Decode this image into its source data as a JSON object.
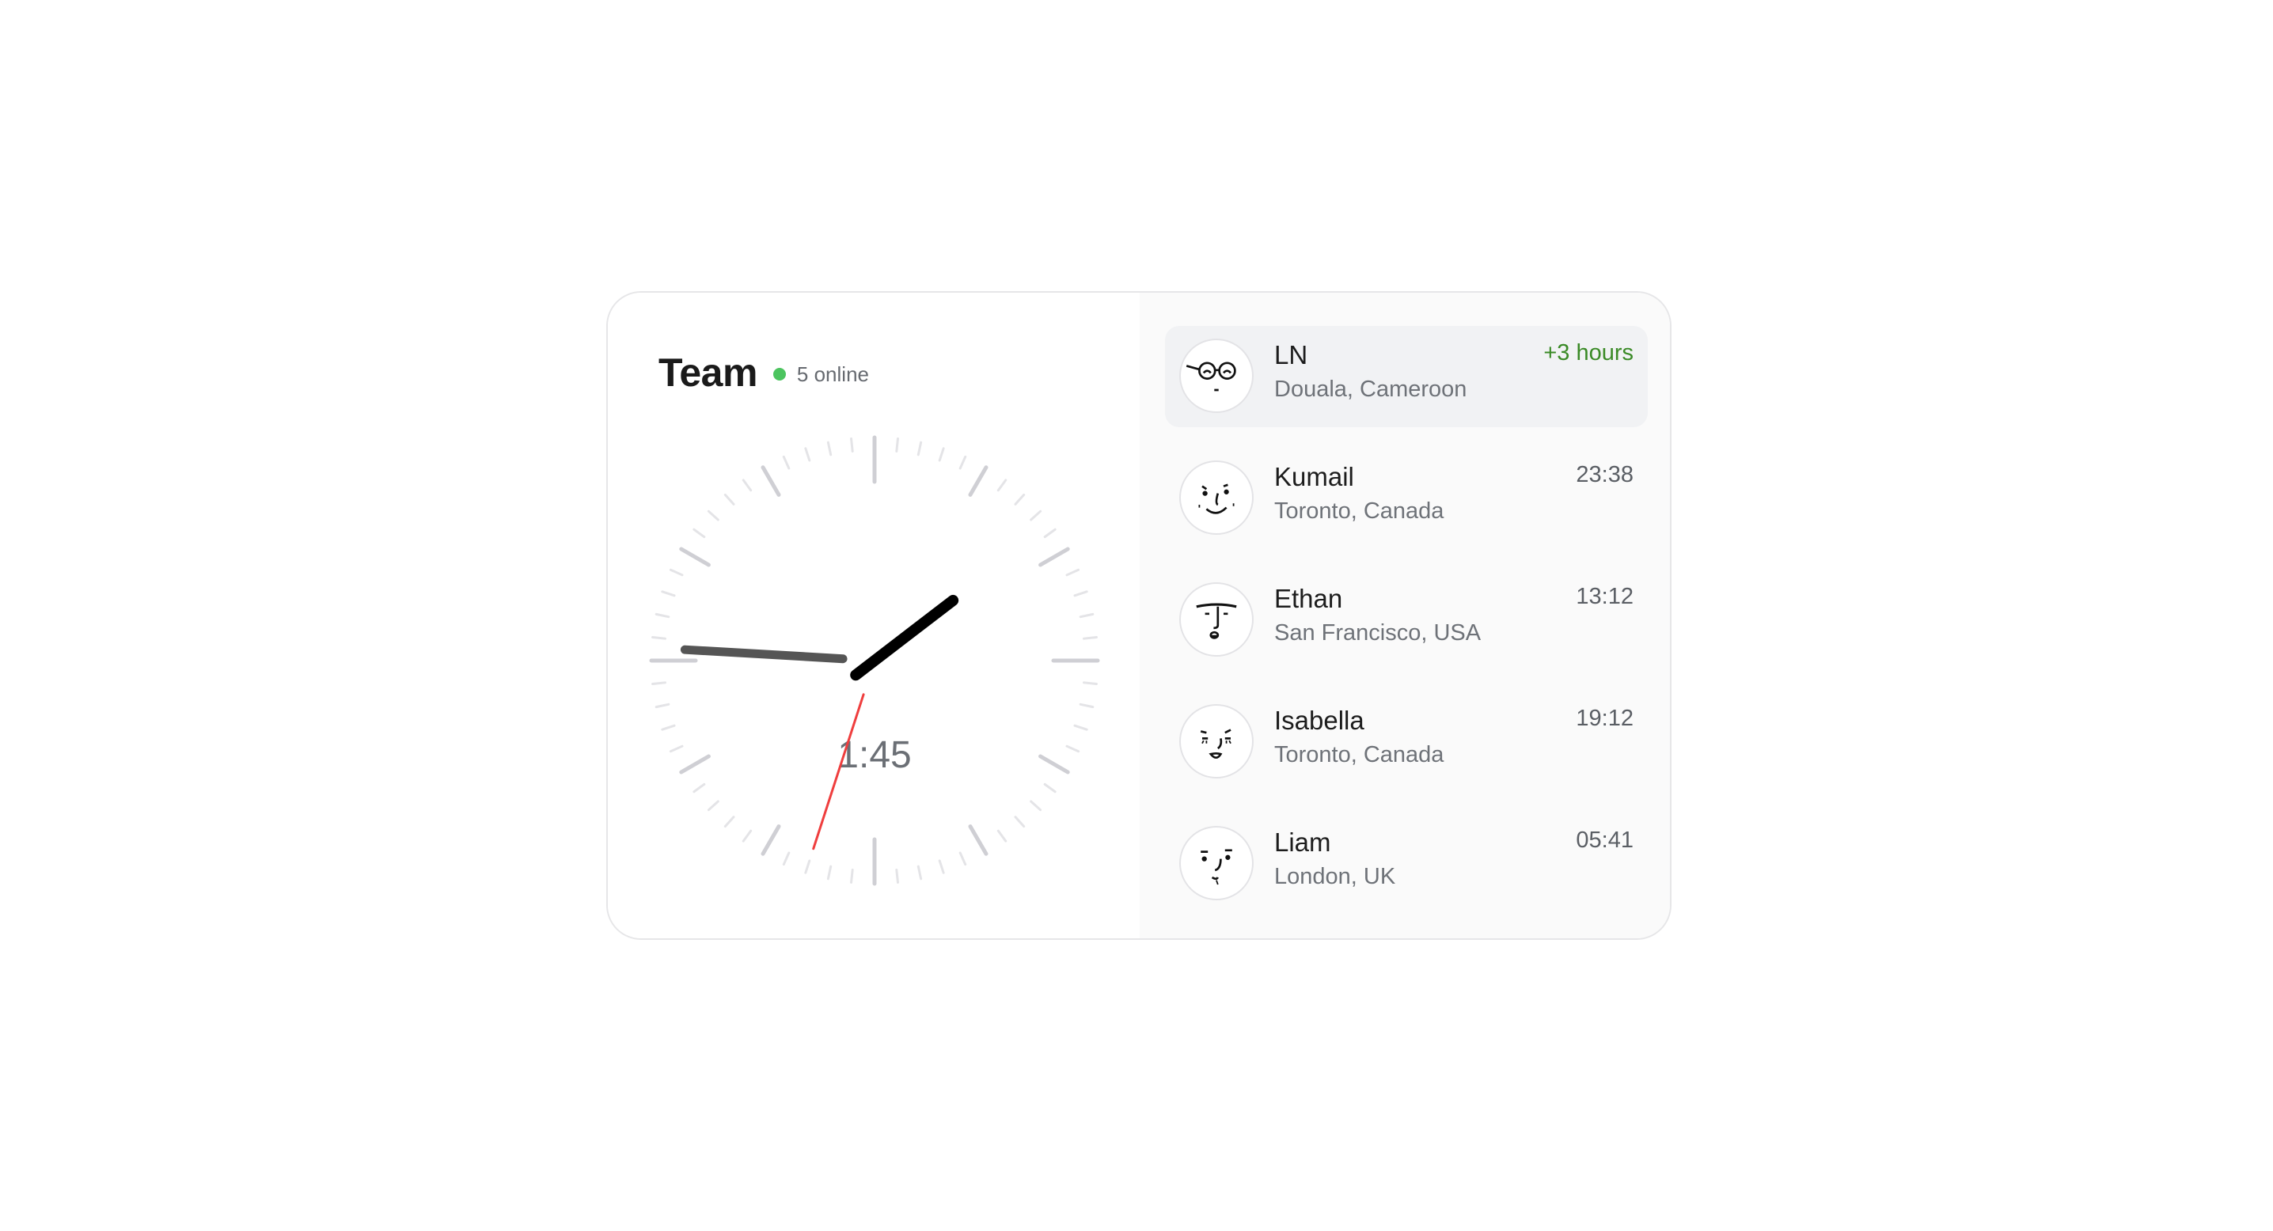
{
  "team": {
    "title": "Team",
    "online": "5 online",
    "online_color": "#4cc45f"
  },
  "clock": {
    "hour": 1,
    "minute": 45,
    "second": 33,
    "digital": "1:45",
    "hour_hand_color": "#000000",
    "minute_hand_color": "#555555",
    "second_hand_color": "#ef3e3e"
  },
  "members": [
    {
      "name": "LN",
      "location": "Douala, Cameroon",
      "time": "+3 hours",
      "avatar_icon": "face-glasses-icon"
    },
    {
      "name": "Kumail",
      "location": "Toronto, Canada",
      "time": "23:38",
      "avatar_icon": "face-smile-icon"
    },
    {
      "name": "Ethan",
      "location": "San Francisco, USA",
      "time": "13:12",
      "avatar_icon": "face-brow-icon"
    },
    {
      "name": "Isabella",
      "location": "Toronto, Canada",
      "time": "19:12",
      "avatar_icon": "face-lashes-icon"
    },
    {
      "name": "Liam",
      "location": "London, UK",
      "time": "05:41",
      "avatar_icon": "face-plain-icon"
    }
  ],
  "colors": {
    "time_diff": "#3a8a26",
    "active_row": "#f1f2f4"
  }
}
